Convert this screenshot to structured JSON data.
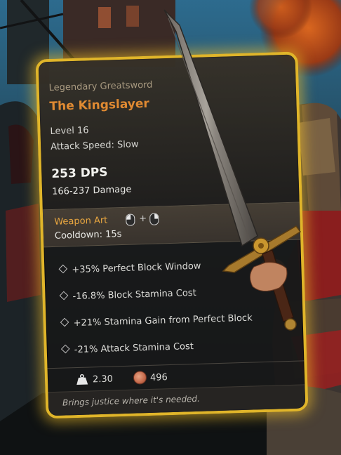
{
  "item": {
    "type_label": "Legendary Greatsword",
    "name": "The Kingslayer",
    "level": "Level 16",
    "attack_speed": "Attack Speed: Slow",
    "dps": "253 DPS",
    "damage": "166-237 Damage",
    "weapon_art": {
      "label": "Weapon Art",
      "plus": "+",
      "cooldown": "Cooldown: 15s",
      "input_icons": [
        "mouse-left-click-icon",
        "mouse-right-click-icon"
      ]
    },
    "stats": [
      "+35% Perfect Block Window",
      "-16.8% Block Stamina Cost",
      "+21% Stamina Gain from Perfect Block",
      "-21% Attack Stamina Cost"
    ],
    "weight": "2.30",
    "value": "496",
    "flavor_text": "Brings justice where it's needed."
  },
  "colors": {
    "border_gold": "#e0b52a",
    "legendary_orange": "#e08a32",
    "weapon_art_orange": "#e8a640"
  }
}
